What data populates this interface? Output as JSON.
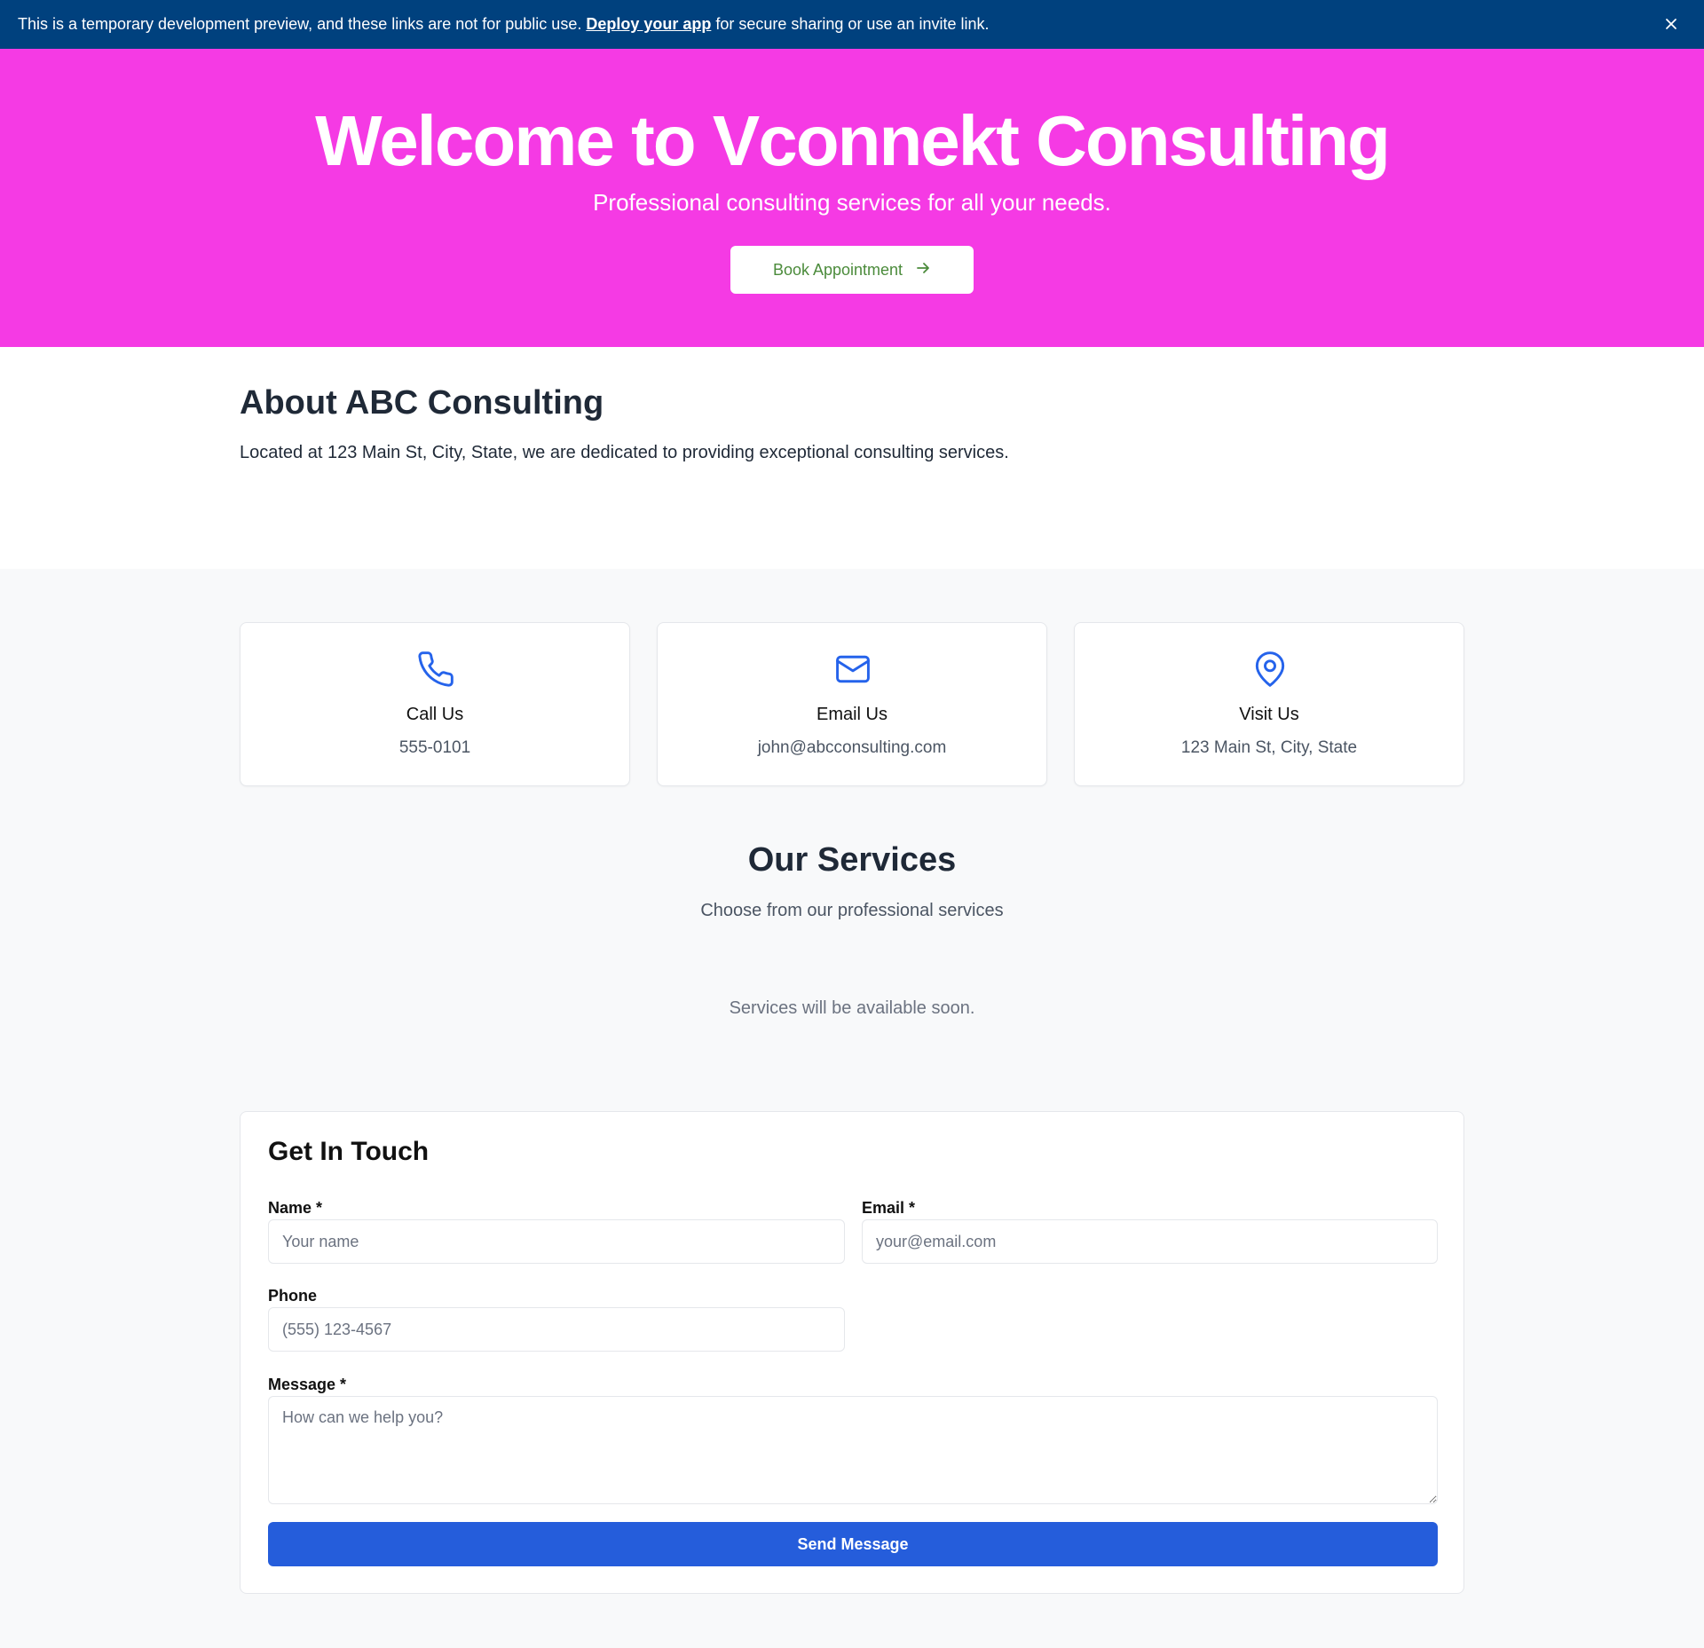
{
  "banner": {
    "text_before": "This is a temporary development preview, and these links are not for public use.",
    "link_text": "Deploy your app",
    "text_after": "for secure sharing or use an invite link.",
    "close_icon": "close-icon"
  },
  "hero": {
    "title": "Welcome to Vconnekt Consulting",
    "subtitle": "Professional consulting services for all your needs.",
    "cta_label": "Book Appointment",
    "cta_icon": "arrow-right-icon",
    "background": "#f53ae4"
  },
  "about": {
    "title": "About ABC Consulting",
    "text": "Located at 123 Main St, City, State, we are dedicated to providing exceptional consulting services."
  },
  "contact_cards": [
    {
      "icon": "phone-icon",
      "title": "Call Us",
      "value": "555-0101"
    },
    {
      "icon": "mail-icon",
      "title": "Email Us",
      "value": "john@abcconsulting.com"
    },
    {
      "icon": "map-pin-icon",
      "title": "Visit Us",
      "value": "123 Main St, City, State"
    }
  ],
  "services": {
    "title": "Our Services",
    "subtitle": "Choose from our professional services",
    "empty_text": "Services will be available soon."
  },
  "form": {
    "title": "Get In Touch",
    "name_label": "Name *",
    "name_placeholder": "Your name",
    "email_label": "Email *",
    "email_placeholder": "your@email.com",
    "phone_label": "Phone",
    "phone_placeholder": "(555) 123-4567",
    "message_label": "Message *",
    "message_placeholder": "How can we help you?",
    "submit_label": "Send Message"
  },
  "colors": {
    "banner": "#00417e",
    "accent": "#255ddb",
    "icon": "#2563eb",
    "cta_text": "#4b8b3b"
  }
}
